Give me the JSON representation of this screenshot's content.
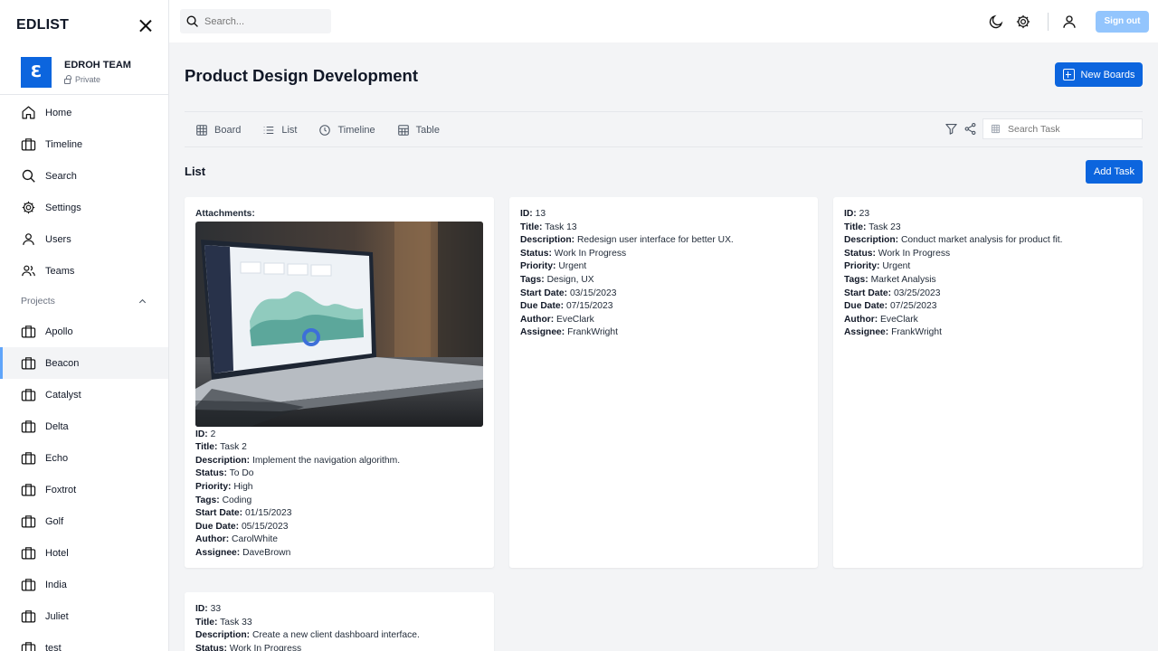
{
  "sidebar": {
    "brand": "EDLIST",
    "team": {
      "logo_letter": "Ɛ",
      "name": "EDROH TEAM",
      "visibility": "Private"
    },
    "nav": [
      {
        "label": "Home",
        "icon": "home-icon"
      },
      {
        "label": "Timeline",
        "icon": "briefcase-icon"
      },
      {
        "label": "Search",
        "icon": "search-icon"
      },
      {
        "label": "Settings",
        "icon": "gear-icon"
      },
      {
        "label": "Users",
        "icon": "user-icon"
      },
      {
        "label": "Teams",
        "icon": "users-icon"
      }
    ],
    "projects_label": "Projects",
    "projects": [
      "Apollo",
      "Beacon",
      "Catalyst",
      "Delta",
      "Echo",
      "Foxtrot",
      "Golf",
      "Hotel",
      "India",
      "Juliet",
      "test"
    ],
    "active_project": "Beacon"
  },
  "topbar": {
    "search_placeholder": "Search...",
    "signout_label": "Sign out"
  },
  "main": {
    "title": "Product Design Development",
    "new_boards_label": "New Boards",
    "tabs": [
      {
        "label": "Board",
        "icon": "grid-icon"
      },
      {
        "label": "List",
        "icon": "list-icon"
      },
      {
        "label": "Timeline",
        "icon": "clock-icon"
      },
      {
        "label": "Table",
        "icon": "table-icon"
      }
    ],
    "active_tab": "List",
    "search_task_placeholder": "Search Task",
    "list_title": "List",
    "add_task_label": "Add Task"
  },
  "tasks": [
    {
      "attachments_label": "Attachments:",
      "id": "2",
      "title": "Task 2",
      "description": "Implement the navigation algorithm.",
      "status": "To Do",
      "priority": "High",
      "tags": "Coding",
      "start_date": "01/15/2023",
      "due_date": "05/15/2023",
      "author": "CarolWhite",
      "assignee": "DaveBrown"
    },
    {
      "id": "13",
      "title": "Task 13",
      "description": "Redesign user interface for better UX.",
      "status": "Work In Progress",
      "priority": "Urgent",
      "tags": "Design, UX",
      "start_date": "03/15/2023",
      "due_date": "07/15/2023",
      "author": "EveClark",
      "assignee": "FrankWright"
    },
    {
      "id": "23",
      "title": "Task 23",
      "description": "Conduct market analysis for product fit.",
      "status": "Work In Progress",
      "priority": "Urgent",
      "tags": "Market Analysis",
      "start_date": "03/25/2023",
      "due_date": "07/25/2023",
      "author": "EveClark",
      "assignee": "FrankWright"
    },
    {
      "id": "33",
      "title": "Task 33",
      "description": "Create a new client dashboard interface.",
      "status": "Work In Progress"
    }
  ],
  "field_labels": {
    "id": "ID:",
    "title": "Title:",
    "description": "Description:",
    "status": "Status:",
    "priority": "Priority:",
    "tags": "Tags:",
    "start_date": "Start Date:",
    "due_date": "Due Date:",
    "author": "Author:",
    "assignee": "Assignee:"
  },
  "colors": {
    "primary": "#0c65de",
    "signout": "#93c5fd",
    "active_indicator": "#60a5fa"
  }
}
